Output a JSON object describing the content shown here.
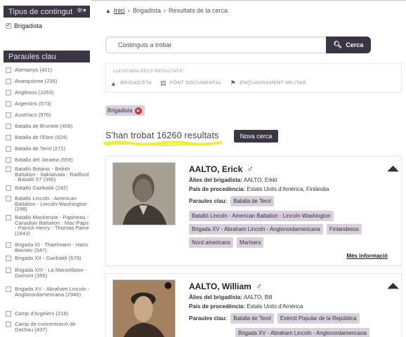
{
  "sidebar": {
    "content_type": {
      "title": "Tipus de contingut",
      "items": [
        {
          "label": "Brigadista",
          "checked": true
        }
      ]
    },
    "keywords": {
      "title": "Paraules clau",
      "items": [
        {
          "label": "Alemanys (421)"
        },
        {
          "label": "Anarquisme (236)"
        },
        {
          "label": "Anglesos (1063)"
        },
        {
          "label": "Argentins (573)"
        },
        {
          "label": "Austríacs (976)"
        },
        {
          "label": "Batalla de Brunete (406)"
        },
        {
          "label": "Batalla de l'Ebre (624)"
        },
        {
          "label": "Batalla de Terol (271)"
        },
        {
          "label": "Batalla del Jarama (559)"
        },
        {
          "label": "Batalló Britànic - British Battalion - Saklatvala - Radford - Batalló 57 (396)"
        },
        {
          "label": "Batalló Garibaldi (242)"
        },
        {
          "label": "Batalló Lincoln - American Battalion - Lincoln-Washington (298)"
        },
        {
          "label": "Batalló Mackenzie - Papineau - Canadian Battalion - Mac-Paps - Patrick Henry - Thomas Paine (1643)"
        },
        {
          "label": "Brigada XI - Thaelmann - Hans Beimler (547)"
        },
        {
          "label": "Brigada XII - Garibaldi (679)"
        },
        {
          "label": "Brigada XIV - La Marseillaise - Dumont (355)"
        },
        {
          "label": "Brigada XV - Abraham Lincoln - Anglonordamericana (2946)"
        },
        {
          "label": "Camp d'Argelers (218)"
        },
        {
          "label": "Camp de concentració de Dachau (437)"
        }
      ]
    }
  },
  "breadcrumb": {
    "home": "Inici",
    "section": "Brigadista",
    "current": "Resultats de la cerca"
  },
  "search": {
    "placeholder": "Continguts a trobar",
    "button_label": "Cerca"
  },
  "legend": {
    "title": "LLEGENDA DELS RESULTATS:",
    "items": [
      {
        "icon": "brigadista-icon",
        "label": "BRIGADISTA"
      },
      {
        "icon": "document-icon",
        "label": "FONT DOCUMENTAL"
      },
      {
        "icon": "flag-icon",
        "label": "ENQUADRAMENT MILITAR"
      }
    ]
  },
  "active_filter": {
    "label": "Brigadista"
  },
  "results": {
    "count_text": "S'han trobat 16260 resultats",
    "new_search_label": "Nova cerca",
    "items": [
      {
        "name": "AALTO, Erick",
        "alias_label": "Àlies del brigadista:",
        "alias": "AALTO, Erkki",
        "country_label": "País de procedència:",
        "country": "Estats Units d'Amèrica, Finlàndia",
        "keywords_label": "Paraules clau:",
        "keywords": [
          "Batalla de Terol",
          "Batalló Lincoln - American Battalion - Lincoln-Washington",
          "Brigada XV - Abraham Lincoln - Anglonordamericana",
          "Finlandesos",
          "Nord americans",
          "Mariners"
        ],
        "more_info": "Més informació"
      },
      {
        "name": "AALTO, William",
        "alias_label": "Àlies del brigadista:",
        "alias": "AALTO, Bill",
        "country_label": "País de procedència:",
        "country": "Estats Units d'Amèrica",
        "keywords_label": "Paraules clau:",
        "keywords": [
          "Batalla de Terol",
          "Exèrcit Popular de la República",
          "Brigada XV - Abraham Lincoln - Anglonordamericana"
        ]
      }
    ]
  },
  "colors": {
    "primary_dark": "#3b3545",
    "tag_bg": "#d8d0dc",
    "highlight": "#f2ec3a",
    "remove_red": "#c0302f"
  }
}
